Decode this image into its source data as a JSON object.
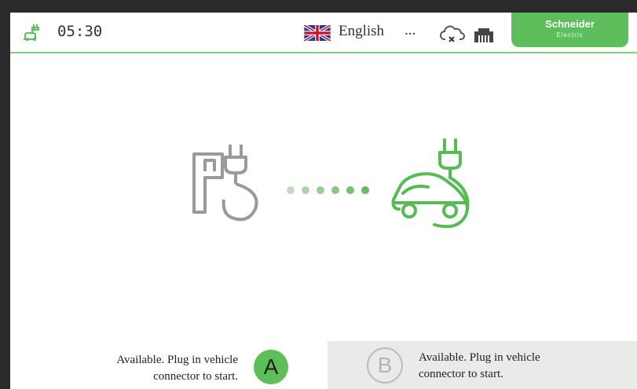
{
  "status": {
    "time": "05:30",
    "plug_status_icon": "plug-status-icon"
  },
  "language": {
    "flag_icon": "uk-flag-icon",
    "label": "English",
    "more": "..."
  },
  "connectivity": {
    "cloud_icon": "cloud-offline-icon",
    "ethernet_icon": "ethernet-icon"
  },
  "brand": {
    "name": "Schneider",
    "sub": "Electric",
    "color": "#5cbf5b"
  },
  "illustration": {
    "station_icon": "charging-station-icon",
    "car_icon": "electric-car-icon",
    "station_color": "#9a9a9a",
    "car_color": "#56bb52",
    "dot_colors": [
      "#c8d8c6",
      "#b3d0b0",
      "#9fcb9b",
      "#8ac686",
      "#74c170",
      "#62bd5e"
    ]
  },
  "connectors": {
    "a": {
      "letter": "A",
      "message_line1": "Available. Plug in vehicle",
      "message_line2": "connector to start.",
      "badge_color": "#5ebf5a"
    },
    "b": {
      "letter": "B",
      "message_line1": "Available. Plug in vehicle",
      "message_line2": "connector to start.",
      "panel_color": "#e9ebe8"
    }
  }
}
